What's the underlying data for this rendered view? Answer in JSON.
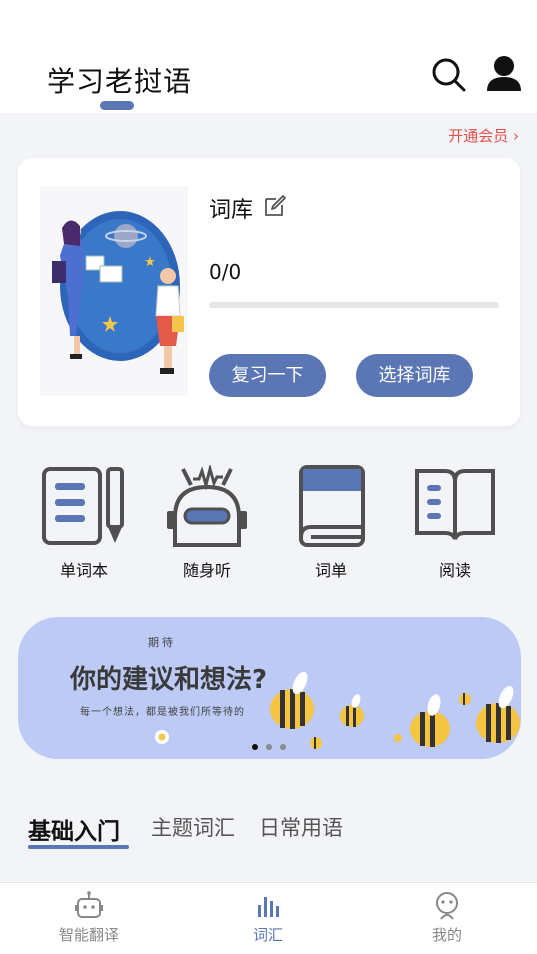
{
  "header": {
    "title": "学习老挝语",
    "search_icon": "search-icon",
    "user_icon": "user-icon"
  },
  "vip": {
    "label": "开通会员 ›"
  },
  "vocab_card": {
    "label": "词库",
    "edit_icon": "edit-icon",
    "progress_text": "0/0",
    "progress_fraction": 0,
    "review_button": "复习一下",
    "choose_button": "选择词库"
  },
  "tools": [
    {
      "label": "单词本",
      "icon": "notebook-icon"
    },
    {
      "label": "随身听",
      "icon": "robot-radio-icon"
    },
    {
      "label": "词单",
      "icon": "book-icon"
    },
    {
      "label": "阅读",
      "icon": "open-book-icon"
    }
  ],
  "banner": {
    "kicker": "期待",
    "title": "你的建议和想法?",
    "subtitle": "每一个想法，都是被我们所等待的",
    "slide_count": 3,
    "active_slide": 0
  },
  "categories": [
    {
      "label": "基础入门",
      "active": true
    },
    {
      "label": "主题词汇",
      "active": false
    },
    {
      "label": "日常用语",
      "active": false
    }
  ],
  "tabbar": [
    {
      "label": "智能翻译",
      "icon": "robot-icon",
      "active": false
    },
    {
      "label": "词汇",
      "icon": "bars-icon",
      "active": true
    },
    {
      "label": "我的",
      "icon": "profile-icon",
      "active": false
    }
  ],
  "colors": {
    "accent": "#5b76b4",
    "vip": "#e0524b",
    "banner": "#bccaf5",
    "background": "#f3f4f7"
  }
}
